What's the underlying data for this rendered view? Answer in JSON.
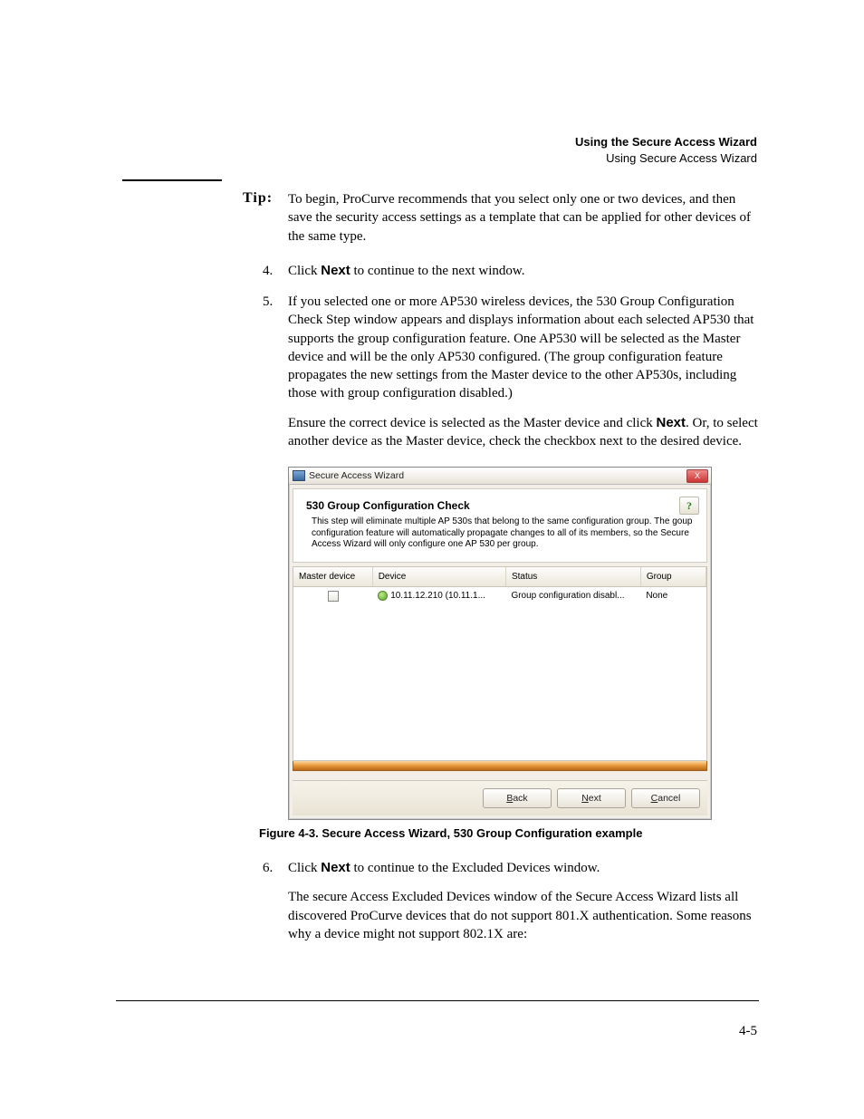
{
  "header": {
    "title_bold": "Using the Secure Access Wizard",
    "subtitle": "Using Secure Access Wizard"
  },
  "tip": {
    "label": "Tip:",
    "body": "To begin, ProCurve recommends that you select only one or two devices, and then save the security access settings as a template that can be applied for other devices of the same type."
  },
  "items": {
    "i4": {
      "num": "4.",
      "pre": "Click ",
      "bold": "Next",
      "post": " to continue to the next window."
    },
    "i5": {
      "num": "5.",
      "p1": "If you selected one or more AP530 wireless devices, the 530 Group Configuration Check Step window appears and displays information about each selected AP530 that supports the group configuration feature. One AP530 will be selected as the Master device and will be the only AP530 configured. (The group configuration feature propagates the new settings from the Master device to the other AP530s, including those with group configuration disabled.)",
      "p2_pre": "Ensure the correct device is selected as the Master device and click ",
      "p2_bold": "Next",
      "p2_post": ". Or, to select another device as the Master device, check the checkbox next to the desired device."
    },
    "i6": {
      "num": "6.",
      "p1_pre": "Click ",
      "p1_bold": "Next",
      "p1_post": " to continue to the Excluded Devices window.",
      "p2": "The secure Access Excluded Devices window of the Secure Access Wizard lists all discovered ProCurve devices that do not support 801.X authentication. Some reasons why a device might not support 802.1X are:"
    }
  },
  "wizard": {
    "title": "Secure Access Wizard",
    "close": "X",
    "help_glyph": "?",
    "heading": "530 Group Configuration Check",
    "desc": "This step will eliminate multiple AP 530s that belong to the same configuration group. The goup configuration feature will automatically propagate changes to all of its members, so the Secure Access Wizard will only configure one AP 530 per group.",
    "cols": {
      "master": "Master device",
      "device": "Device",
      "status": "Status",
      "group": "Group"
    },
    "row": {
      "device": "10.11.12.210 (10.11.1...",
      "status": "Group configuration disabl...",
      "group": "None"
    },
    "buttons": {
      "back_u": "B",
      "back_rest": "ack",
      "next_u": "N",
      "next_rest": "ext",
      "cancel_u": "C",
      "cancel_rest": "ancel"
    }
  },
  "figcap": "Figure 4-3. Secure Access Wizard, 530 Group Configuration example",
  "pagenum": "4-5"
}
